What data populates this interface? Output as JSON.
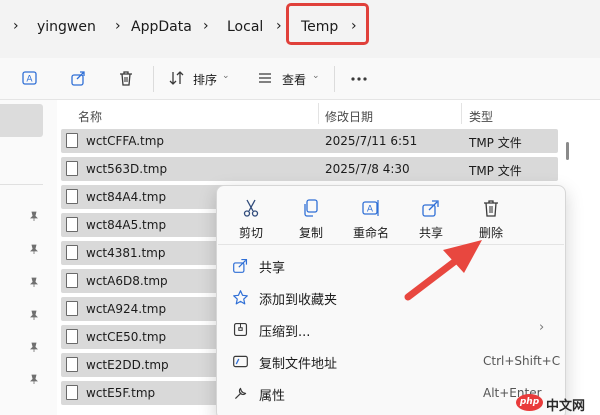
{
  "breadcrumb": {
    "items": [
      "yingwen",
      "AppData",
      "Local",
      "Temp"
    ]
  },
  "toolbar": {
    "sort_label": "排序",
    "view_label": "查看"
  },
  "columns": {
    "name": "名称",
    "modified": "修改日期",
    "type": "类型"
  },
  "files": [
    {
      "name": "wctCFFA.tmp",
      "date": "2025/7/11 6:51",
      "type": "TMP 文件"
    },
    {
      "name": "wct563D.tmp",
      "date": "2025/7/8 4:30",
      "type": "TMP 文件"
    },
    {
      "name": "wct84A4.tmp",
      "date": "",
      "type": ""
    },
    {
      "name": "wct84A5.tmp",
      "date": "",
      "type": ""
    },
    {
      "name": "wct4381.tmp",
      "date": "",
      "type": ""
    },
    {
      "name": "wctA6D8.tmp",
      "date": "",
      "type": ""
    },
    {
      "name": "wctA924.tmp",
      "date": "",
      "type": ""
    },
    {
      "name": "wctCE50.tmp",
      "date": "",
      "type": ""
    },
    {
      "name": "wctE2DD.tmp",
      "date": "",
      "type": ""
    },
    {
      "name": "wctE5F.tmp",
      "date": "",
      "type": ""
    }
  ],
  "context_menu": {
    "quick_actions": [
      {
        "label": "剪切",
        "icon": "cut-icon"
      },
      {
        "label": "复制",
        "icon": "copy-icon"
      },
      {
        "label": "重命名",
        "icon": "rename-icon"
      },
      {
        "label": "共享",
        "icon": "share-icon"
      },
      {
        "label": "删除",
        "icon": "delete-icon"
      }
    ],
    "items": [
      {
        "label": "共享",
        "icon": "share-icon",
        "shortcut": "",
        "submenu": false
      },
      {
        "label": "添加到收藏夹",
        "icon": "star-icon",
        "shortcut": "",
        "submenu": false
      },
      {
        "label": "压缩到...",
        "icon": "zip-icon",
        "shortcut": "",
        "submenu": true
      },
      {
        "label": "复制文件地址",
        "icon": "copy-path-icon",
        "shortcut": "Ctrl+Shift+C",
        "submenu": false
      },
      {
        "label": "属性",
        "icon": "properties-icon",
        "shortcut": "Alt+Enter",
        "submenu": false
      }
    ]
  },
  "watermark": {
    "badge": "php",
    "text": "中文网"
  },
  "colors": {
    "highlight": "#e0403a",
    "accent": "#2f6fd6",
    "selection": "#d9d9d9"
  }
}
